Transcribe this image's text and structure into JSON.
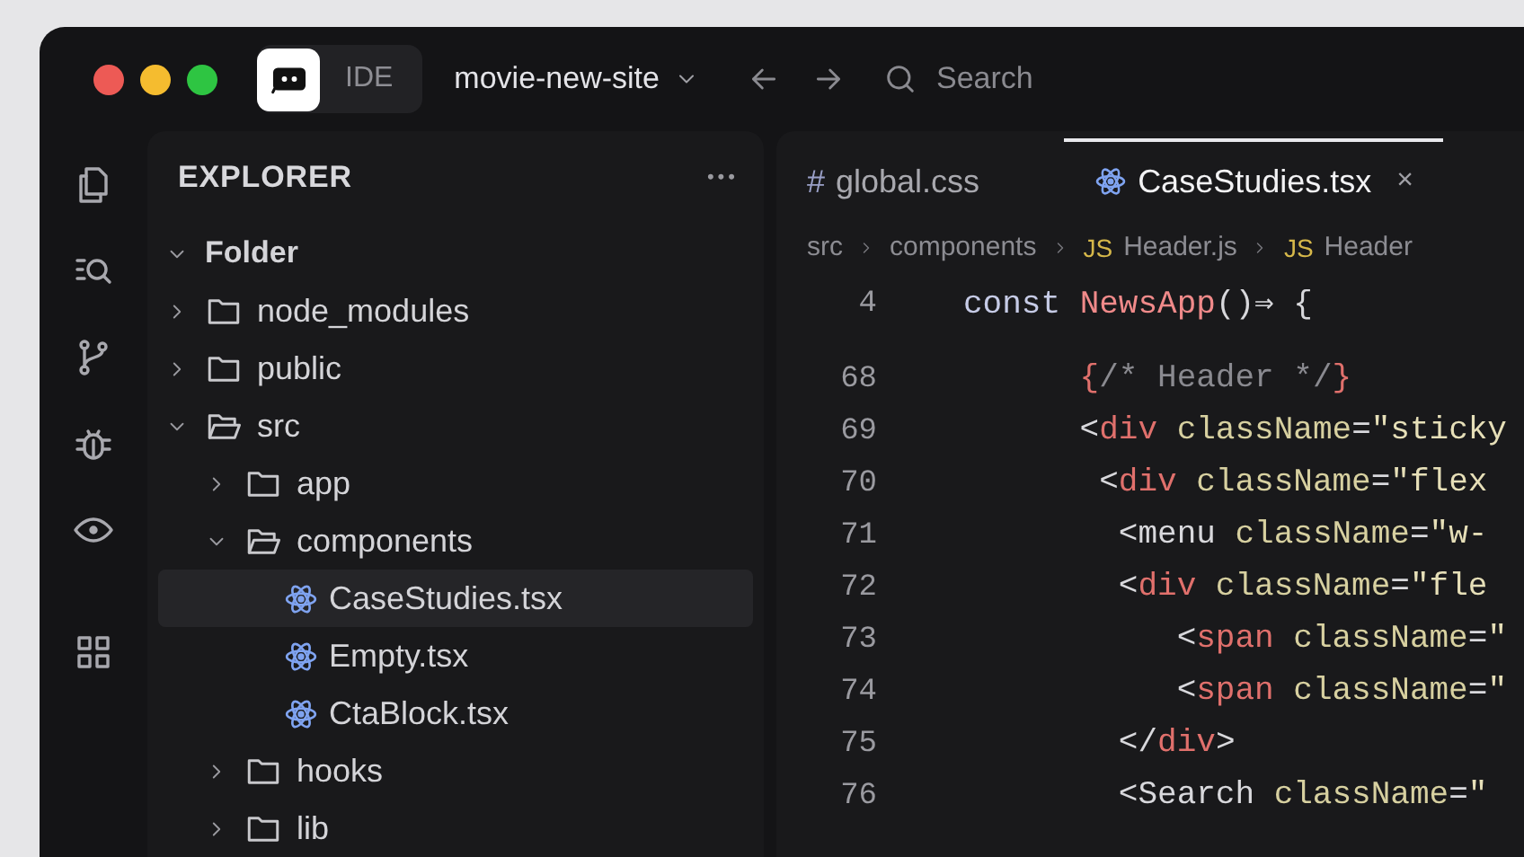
{
  "title_bar": {
    "app_label": "IDE",
    "project": "movie-new-site",
    "search": {
      "placeholder": "Search"
    }
  },
  "activity_bar": [
    {
      "kind": "files"
    },
    {
      "kind": "search"
    },
    {
      "kind": "git"
    },
    {
      "kind": "debug"
    },
    {
      "kind": "preview"
    },
    {
      "kind": "extensions"
    }
  ],
  "explorer": {
    "title": "EXPLORER",
    "more": "•••",
    "tree": [
      {
        "kind": "root",
        "label": "Folder",
        "expanded": true,
        "selected": false,
        "children": [
          {
            "kind": "folder",
            "label": "node_modules",
            "expanded": false,
            "selected": false
          },
          {
            "kind": "folder",
            "label": "public",
            "expanded": false,
            "selected": false
          },
          {
            "kind": "folder",
            "label": "src",
            "expanded": true,
            "selected": false,
            "children": [
              {
                "kind": "folder",
                "label": "app",
                "expanded": false,
                "selected": false
              },
              {
                "kind": "folder",
                "label": "components",
                "expanded": true,
                "selected": false,
                "children": [
                  {
                    "kind": "file",
                    "label": "CaseStudies.tsx",
                    "selected": true
                  },
                  {
                    "kind": "file",
                    "label": "Empty.tsx",
                    "selected": false
                  },
                  {
                    "kind": "file",
                    "label": "CtaBlock.tsx",
                    "selected": false
                  }
                ]
              },
              {
                "kind": "folder",
                "label": "hooks",
                "expanded": false,
                "selected": false
              },
              {
                "kind": "folder",
                "label": "lib",
                "expanded": false,
                "selected": false
              }
            ]
          }
        ]
      }
    ]
  },
  "tabs": [
    {
      "kind": "css",
      "icon_text": "#",
      "label": "global.css",
      "selected": false
    },
    {
      "kind": "react",
      "label": "CaseStudies.tsx",
      "selected": true,
      "close": "×"
    }
  ],
  "breadcrumb": [
    {
      "label": "src"
    },
    {
      "label": "components"
    },
    {
      "badge": "JS",
      "label": "Header.js"
    },
    {
      "badge": "JS",
      "label": "Header"
    }
  ],
  "code": [
    {
      "number": "4",
      "tokens": [
        {
          "kind": "keyword",
          "text": "const "
        },
        {
          "kind": "func",
          "text": "NewsApp"
        },
        {
          "kind": "punct",
          "text": "()⇒ {"
        }
      ]
    },
    {
      "number": "68",
      "tokens": [
        {
          "kind": "tag",
          "text": "      {"
        },
        {
          "kind": "comment",
          "text": "/* Header */"
        },
        {
          "kind": "tag",
          "text": "}"
        }
      ]
    },
    {
      "number": "69",
      "tokens": [
        {
          "kind": "punct",
          "text": "      <"
        },
        {
          "kind": "tag",
          "text": "div"
        },
        {
          "kind": "attr",
          "text": " className"
        },
        {
          "kind": "punct",
          "text": "="
        },
        {
          "kind": "string",
          "text": "\"sticky"
        }
      ]
    },
    {
      "number": "70",
      "tokens": [
        {
          "kind": "punct",
          "text": "       <"
        },
        {
          "kind": "tag",
          "text": "div"
        },
        {
          "kind": "attr",
          "text": " className"
        },
        {
          "kind": "punct",
          "text": "="
        },
        {
          "kind": "string",
          "text": "\"flex"
        }
      ]
    },
    {
      "number": "71",
      "tokens": [
        {
          "kind": "punct",
          "text": "        <menu"
        },
        {
          "kind": "attr",
          "text": " className"
        },
        {
          "kind": "punct",
          "text": "="
        },
        {
          "kind": "string",
          "text": "\"w-"
        }
      ]
    },
    {
      "number": "72",
      "tokens": [
        {
          "kind": "punct",
          "text": "        <"
        },
        {
          "kind": "tag",
          "text": "div"
        },
        {
          "kind": "attr",
          "text": " className"
        },
        {
          "kind": "punct",
          "text": "="
        },
        {
          "kind": "string",
          "text": "\"fle"
        }
      ]
    },
    {
      "number": "73",
      "tokens": [
        {
          "kind": "punct",
          "text": "           <"
        },
        {
          "kind": "tag",
          "text": "span"
        },
        {
          "kind": "attr",
          "text": " className"
        },
        {
          "kind": "punct",
          "text": "="
        },
        {
          "kind": "string",
          "text": "\""
        }
      ]
    },
    {
      "number": "74",
      "tokens": [
        {
          "kind": "punct",
          "text": "           <"
        },
        {
          "kind": "tag",
          "text": "span"
        },
        {
          "kind": "attr",
          "text": " className"
        },
        {
          "kind": "punct",
          "text": "="
        },
        {
          "kind": "string",
          "text": "\""
        }
      ]
    },
    {
      "number": "75",
      "tokens": [
        {
          "kind": "punct",
          "text": "        </"
        },
        {
          "kind": "tag",
          "text": "div"
        },
        {
          "kind": "punct",
          "text": ">"
        }
      ]
    },
    {
      "number": "76",
      "tokens": [
        {
          "kind": "punct",
          "text": "        <Search"
        },
        {
          "kind": "attr",
          "text": " className"
        },
        {
          "kind": "punct",
          "text": "="
        },
        {
          "kind": "string",
          "text": "\""
        }
      ]
    }
  ]
}
